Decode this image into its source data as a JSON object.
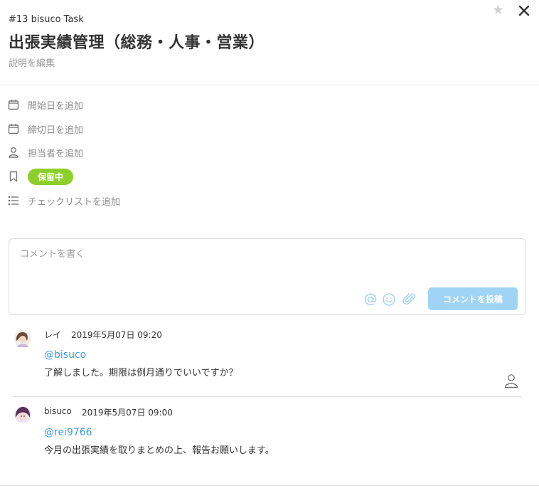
{
  "task": {
    "id_label": "#13 bisuco Task",
    "title": "出張実績管理（総務・人事・営業）",
    "description_link": "説明を編集"
  },
  "properties": {
    "start_date": "開始日を追加",
    "due_date": "締切日を追加",
    "assignee": "担当者を追加",
    "status": "保留中",
    "checklist": "チェックリストを追加"
  },
  "comment_form": {
    "placeholder": "コメントを書く",
    "post_button": "コメントを投稿"
  },
  "comments": [
    {
      "author": "レイ",
      "date": "2019年5月07日 09:20",
      "mention": "@bisuco",
      "body": "了解しました。期限は例月通りでいいですか？"
    },
    {
      "author": "bisuco",
      "date": "2019年5月07日 09:00",
      "mention": "@rei9766",
      "body": "今月の出張実績を取りまとめの上、報告お願いします。"
    }
  ],
  "icons": {
    "star": "star-icon",
    "close": "close-icon",
    "calendar": "calendar-icon",
    "person": "person-icon",
    "bookmark": "bookmark-icon",
    "list": "list-icon",
    "at": "at-icon",
    "smiley": "smiley-icon",
    "paperclip": "paperclip-icon"
  },
  "colors": {
    "status": "#8ccf2a",
    "accent": "#3d9be0",
    "post_button": "#9fd4f7"
  }
}
